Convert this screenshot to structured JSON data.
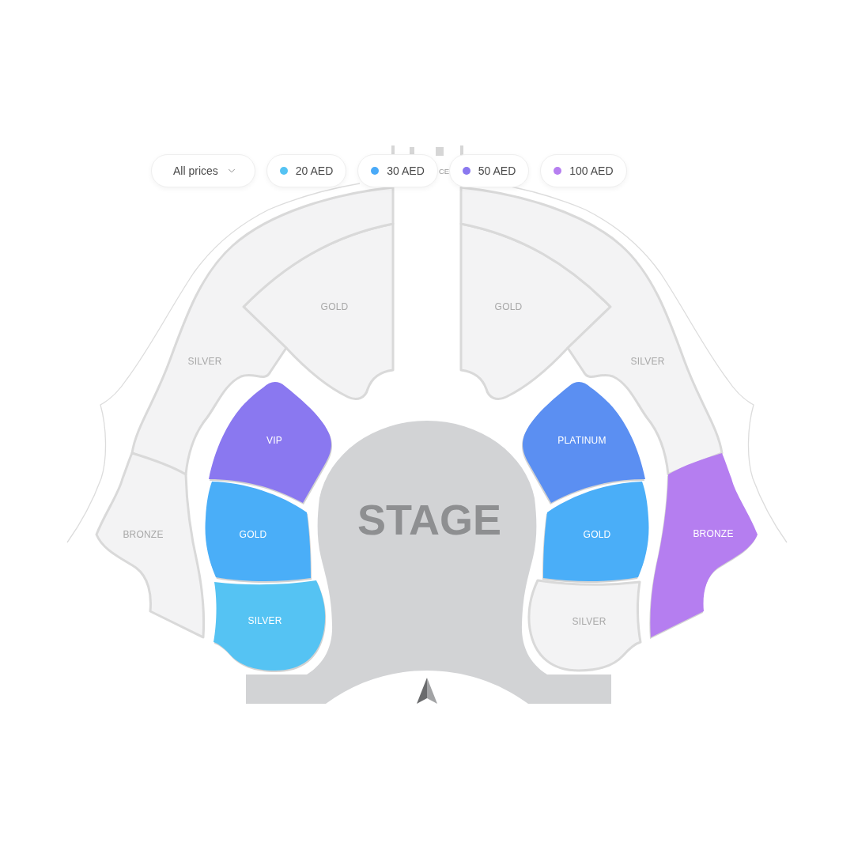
{
  "filters": {
    "price_menu": {
      "label": "All prices"
    },
    "prices": [
      {
        "label": "20 AED",
        "color": "#55c3f3"
      },
      {
        "label": "30 AED",
        "color": "#4aaaf8"
      },
      {
        "label": "50 AED",
        "color": "#8a78ef"
      },
      {
        "label": "100 AED",
        "color": "#b67ff0"
      }
    ]
  },
  "map": {
    "label_fragment": "CE",
    "sections": [
      {
        "label": "GOLD",
        "available": false
      },
      {
        "label": "GOLD",
        "available": false
      },
      {
        "label": "SILVER",
        "available": false
      },
      {
        "label": "SILVER",
        "available": false
      },
      {
        "label": "VIP",
        "available": true,
        "color": "#8a78f0"
      },
      {
        "label": "PLATINUM",
        "available": true,
        "color": "#5b8ff2"
      },
      {
        "label": "BRONZE",
        "available": false
      },
      {
        "label": "GOLD",
        "available": true,
        "color": "#4aaef8"
      },
      {
        "label": "GOLD",
        "available": true,
        "color": "#4aaef8"
      },
      {
        "label": "BRONZE",
        "available": true,
        "color": "#b57ef0"
      },
      {
        "label": "SILVER",
        "available": true,
        "color": "#55c3f3"
      },
      {
        "label": "SILVER",
        "available": false
      }
    ],
    "stage": {
      "label": "STAGE"
    }
  }
}
